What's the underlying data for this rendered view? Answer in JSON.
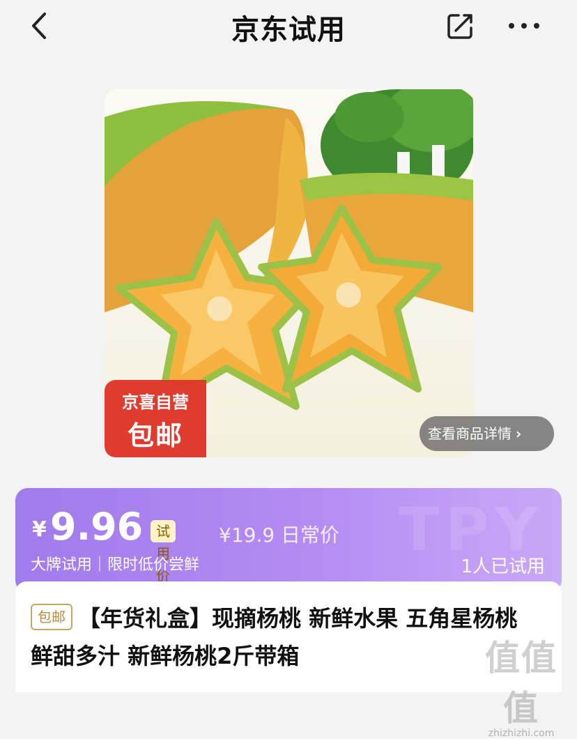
{
  "header": {
    "title": "京东试用",
    "back_icon": "chevron-left-icon",
    "share_icon": "share-icon",
    "more_icon": "more-icon"
  },
  "product_image": {
    "badge_top": "京喜自营",
    "badge_main": "包邮",
    "detail_button": "查看商品详情"
  },
  "price_card": {
    "currency": "¥",
    "trial_price": "9.96",
    "trial_tag": "试用价",
    "original_price": "¥19.9 日常价",
    "subtitle_left": "大牌试用｜限时低价尝鲜",
    "trial_count": "1人已试用",
    "watermark": "TPY"
  },
  "product": {
    "shipping_tag": "包邮",
    "title": "【年货礼盒】现摘杨桃 新鲜水果 五角星杨桃 鲜甜多汁 新鲜杨桃2斤带箱"
  },
  "watermark": {
    "glyph": "值值值",
    "url": "zhizhizhi.com"
  },
  "colors": {
    "price_card_start": "#a07bec",
    "price_card_end": "#c9a8f7",
    "badge_red": "#df3b2f"
  }
}
